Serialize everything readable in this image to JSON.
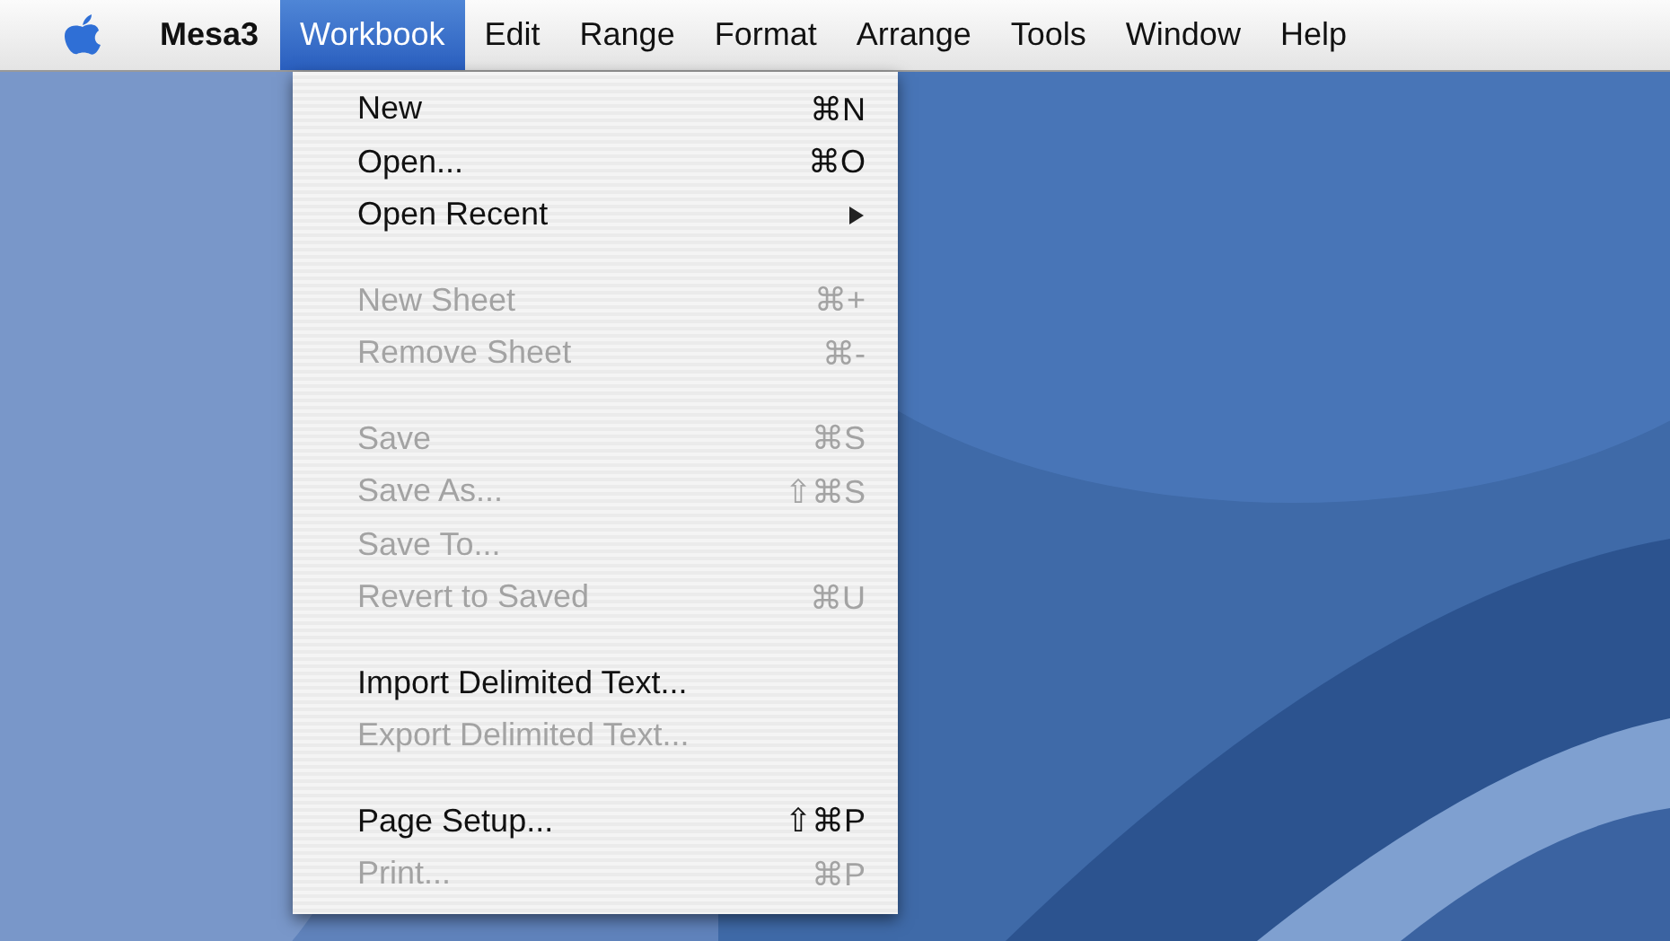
{
  "menubar": {
    "app": "Mesa3",
    "items": [
      {
        "label": "Workbook",
        "selected": true
      },
      {
        "label": "Edit",
        "selected": false
      },
      {
        "label": "Range",
        "selected": false
      },
      {
        "label": "Format",
        "selected": false
      },
      {
        "label": "Arrange",
        "selected": false
      },
      {
        "label": "Tools",
        "selected": false
      },
      {
        "label": "Window",
        "selected": false
      },
      {
        "label": "Help",
        "selected": false
      }
    ]
  },
  "menu": {
    "sections": [
      [
        {
          "label": "New",
          "shortcut": "⌘N",
          "disabled": false,
          "kind": "command"
        },
        {
          "label": "Open...",
          "shortcut": "⌘O",
          "disabled": false,
          "kind": "command"
        },
        {
          "label": "Open Recent",
          "disabled": false,
          "kind": "submenu"
        }
      ],
      [
        {
          "label": "New Sheet",
          "shortcut": "⌘+",
          "disabled": true,
          "kind": "command"
        },
        {
          "label": "Remove Sheet",
          "shortcut": "⌘-",
          "disabled": true,
          "kind": "command"
        }
      ],
      [
        {
          "label": "Save",
          "shortcut": "⌘S",
          "disabled": true,
          "kind": "command"
        },
        {
          "label": "Save As...",
          "shortcut": "⇧⌘S",
          "disabled": true,
          "kind": "command"
        },
        {
          "label": "Save To...",
          "disabled": true,
          "kind": "command"
        },
        {
          "label": "Revert to Saved",
          "shortcut": "⌘U",
          "disabled": true,
          "kind": "command"
        }
      ],
      [
        {
          "label": "Import Delimited Text...",
          "disabled": false,
          "kind": "command"
        },
        {
          "label": "Export Delimited Text...",
          "disabled": true,
          "kind": "command"
        }
      ],
      [
        {
          "label": "Page Setup...",
          "shortcut": "⇧⌘P",
          "disabled": false,
          "kind": "command"
        },
        {
          "label": "Print...",
          "shortcut": "⌘P",
          "disabled": true,
          "kind": "command"
        }
      ]
    ]
  }
}
